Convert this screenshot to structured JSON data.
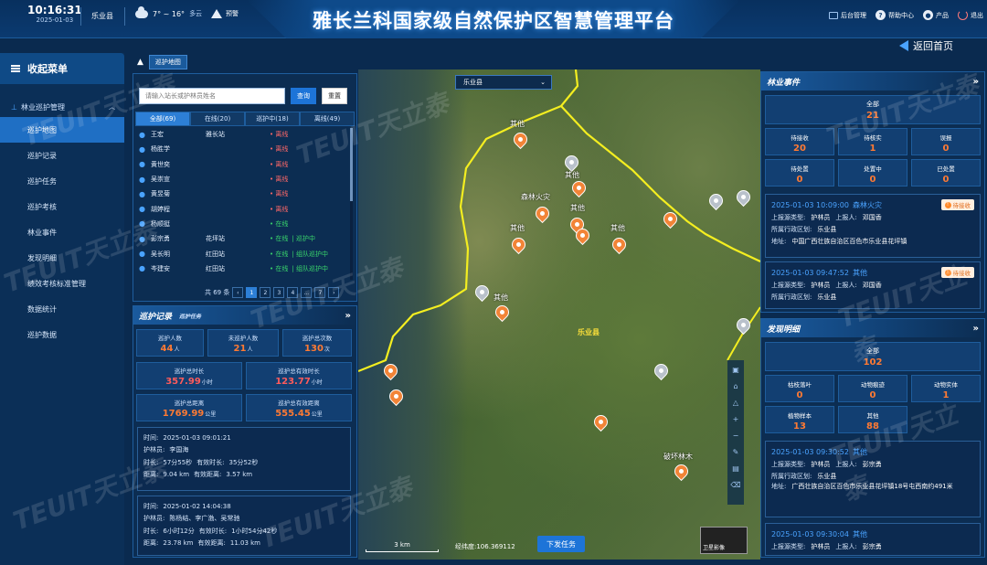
{
  "header": {
    "time": "10:16:31",
    "date": "2025-01-03",
    "location": "乐业县",
    "weather_temp": "7° ~ 16°",
    "weather_cond": "多云",
    "warning_label": "预警",
    "title": "雅长兰科国家级自然保护区智慧管理平台",
    "right_items": [
      {
        "label": "后台管理",
        "icon": "monitor-icon"
      },
      {
        "label": "帮助中心",
        "icon": "help-icon"
      },
      {
        "label": "产品",
        "icon": "user-icon"
      },
      {
        "label": "退出",
        "icon": "power-icon"
      }
    ],
    "return_label": "返回首页"
  },
  "nav": {
    "head": "收起菜单",
    "group": "林业巡护管理",
    "items": [
      "巡护地图",
      "巡护记录",
      "巡护任务",
      "巡护考核",
      "林业事件",
      "发现明细",
      "绩效考核标准管理",
      "数据统计",
      "巡护数据"
    ]
  },
  "breadcrumb": {
    "current": "巡护地图"
  },
  "search": {
    "placeholder": "请输入站长或护林员姓名",
    "query_label": "查询",
    "reset_label": "重置"
  },
  "tabs": [
    {
      "label": "全部(69)"
    },
    {
      "label": "在线(20)"
    },
    {
      "label": "巡护中(18)"
    },
    {
      "label": "离线(49)"
    }
  ],
  "rangers": [
    {
      "name": "王宏",
      "station": "雅长站",
      "status": "离线",
      "online": false,
      "mid": ""
    },
    {
      "name": "杨胜学",
      "station": "",
      "status": "离线",
      "online": false,
      "mid": ""
    },
    {
      "name": "黄世奕",
      "station": "",
      "status": "离线",
      "online": false,
      "mid": ""
    },
    {
      "name": "吴崇宣",
      "station": "",
      "status": "离线",
      "online": false,
      "mid": ""
    },
    {
      "name": "黄昱菊",
      "station": "",
      "status": "离线",
      "online": false,
      "mid": ""
    },
    {
      "name": "胡婷程",
      "station": "",
      "status": "离线",
      "online": false,
      "mid": ""
    },
    {
      "name": "杨顺挺",
      "station": "",
      "status": "在线",
      "online": true,
      "mid": ""
    },
    {
      "name": "彭宗勇",
      "station": "花坪站",
      "status": "在线",
      "online": true,
      "mid": "| 巡护中"
    },
    {
      "name": "吴长明",
      "station": "红田站",
      "status": "在线",
      "online": true,
      "mid": "| 组队巡护中"
    },
    {
      "name": "岑建安",
      "station": "红田站",
      "status": "在线",
      "online": true,
      "mid": "| 组队巡护中"
    }
  ],
  "pager": {
    "total": "共 69 条",
    "pages": [
      "1",
      "2",
      "3",
      "4",
      "...",
      "7"
    ],
    "prev": "‹",
    "next": "›"
  },
  "patrol": {
    "title": "巡护记录",
    "subtitle": "巡护任务",
    "stats_top": [
      {
        "label": "巡护人数",
        "value": "44",
        "unit": "人"
      },
      {
        "label": "未巡护人数",
        "value": "21",
        "unit": "人"
      },
      {
        "label": "巡护总次数",
        "value": "130",
        "unit": "次"
      }
    ],
    "stats_mid": [
      {
        "label": "巡护总时长",
        "value": "357.99",
        "unit": "小时"
      },
      {
        "label": "巡护总有效时长",
        "value": "123.77",
        "unit": "小时"
      }
    ],
    "stats_bot": [
      {
        "label": "巡护总距离",
        "value": "1769.99",
        "unit": "公里"
      },
      {
        "label": "巡护总有效距离",
        "value": "555.45",
        "unit": "公里"
      }
    ],
    "records": [
      {
        "time_label": "时间:",
        "time": "2025-01-03 09:01:21",
        "ranger_label": "护林员:",
        "ranger": "李国海",
        "dur_label": "时长:",
        "dur": "57分55秒",
        "eff_dur_label": "有效时长:",
        "eff_dur": "35分52秒",
        "dist_label": "距离:",
        "dist": "9.04 km",
        "eff_dist_label": "有效距离:",
        "eff_dist": "3.57 km"
      },
      {
        "time_label": "时间:",
        "time": "2025-01-02 14:04:38",
        "ranger_label": "护林员:",
        "ranger": "陈杨结、李广渤、吴常驰",
        "dur_label": "时长:",
        "dur": "6小时12分",
        "eff_dur_label": "有效时长:",
        "eff_dur": "1小时54分42秒",
        "dist_label": "距离:",
        "dist": "23.78 km",
        "eff_dist_label": "有效距离:",
        "eff_dist": "11.03 km"
      }
    ]
  },
  "map": {
    "district_select": "乐业县",
    "county_label": "乐业县",
    "pins": [
      {
        "label": "其他"
      },
      {
        "label": "其他"
      },
      {
        "label": "森林火灾"
      },
      {
        "label": "其他"
      },
      {
        "label": "其他"
      },
      {
        "label": "其他"
      },
      {
        "label": "其他"
      },
      {
        "label": "破坏林木"
      }
    ],
    "scale": "3 km",
    "coord": "经纬度:106.369112",
    "dispatch_label": "下发任务",
    "minimap_label": "卫星影像"
  },
  "events": {
    "title": "林业事件",
    "all_label": "全部",
    "all_value": "21",
    "stats": [
      {
        "label": "待接收",
        "value": "20"
      },
      {
        "label": "待核实",
        "value": "1"
      },
      {
        "label": "误报",
        "value": "0"
      },
      {
        "label": "待处置",
        "value": "0"
      },
      {
        "label": "处置中",
        "value": "0"
      },
      {
        "label": "已处置",
        "value": "0"
      }
    ],
    "cards": [
      {
        "time": "2025-01-03 10:09:00",
        "cat": "森林火灾",
        "badge": "待接收",
        "src_label": "上报源类型:",
        "src": "护林员",
        "rep_label": "上报人:",
        "rep": "邓国香",
        "area_label": "所属行政区划:",
        "area": "乐业县",
        "addr_label": "地址:",
        "addr": "中国广西壮族自治区百色市乐业县花坪镇"
      },
      {
        "time": "2025-01-03 09:47:52",
        "cat": "其他",
        "badge": "待接收",
        "src_label": "上报源类型:",
        "src": "护林员",
        "rep_label": "上报人:",
        "rep": "邓国香",
        "area_label": "所属行政区划:",
        "area": "乐业县"
      }
    ]
  },
  "findings": {
    "title": "发现明细",
    "all_label": "全部",
    "all_value": "102",
    "stats": [
      {
        "label": "枯枝落叶",
        "value": "0"
      },
      {
        "label": "动物痕迹",
        "value": "0"
      },
      {
        "label": "动物实体",
        "value": "1"
      },
      {
        "label": "植物样本",
        "value": "13"
      },
      {
        "label": "其他",
        "value": "88"
      }
    ],
    "cards": [
      {
        "time": "2025-01-03 09:30:52",
        "cat": "其他",
        "src_label": "上报源类型:",
        "src": "护林员",
        "rep_label": "上报人:",
        "rep": "彭宗勇",
        "area_label": "所属行政区划:",
        "area": "乐业县",
        "addr_label": "地址:",
        "addr": "广西壮族自治区百色市乐业县花坪镇18号屯西南约491米"
      },
      {
        "time": "2025-01-03 09:30:04",
        "cat": "其他",
        "src_label": "上报源类型:",
        "src": "护林员",
        "rep_label": "上报人:",
        "rep": "彭宗勇"
      }
    ]
  },
  "watermark_text": "TEUIT天立泰",
  "colors": {
    "accent": "#1d74d8",
    "alert": "#ff7a33",
    "offline": "#ff6868",
    "online": "#39d46b",
    "highlight_label": "#ffe23a"
  }
}
